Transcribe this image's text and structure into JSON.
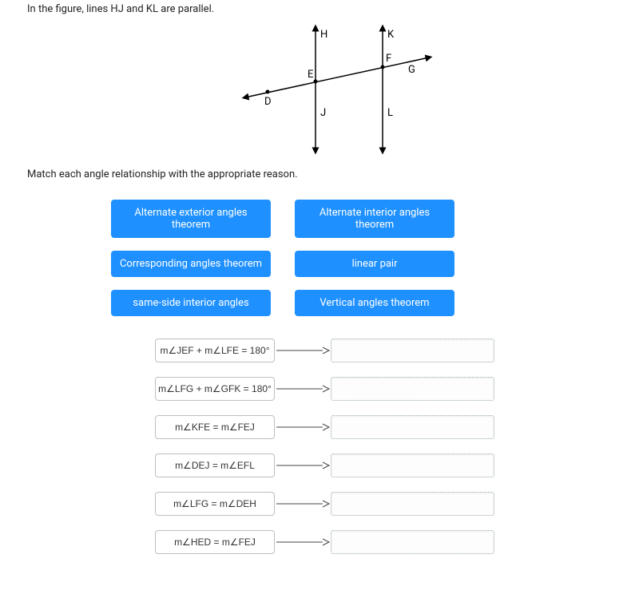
{
  "intro": "In the figure, lines HJ and KL are parallel.",
  "instruction": "Match each angle relationship with the appropriate reason.",
  "figure": {
    "labels": {
      "H": "H",
      "J": "J",
      "K": "K",
      "L": "L",
      "D": "D",
      "E": "E",
      "F": "F",
      "G": "G"
    }
  },
  "chips": [
    [
      "Alternate exterior angles theorem",
      "Alternate interior angles theorem"
    ],
    [
      "Corresponding angles theorem",
      "linear pair"
    ],
    [
      "same-side interior angles",
      "Vertical angles theorem"
    ]
  ],
  "matches": [
    {
      "lhs": "m∠JEF + m∠LFE = 180°"
    },
    {
      "lhs": "m∠LFG + m∠GFK = 180°"
    },
    {
      "lhs": "m∠KFE = m∠FEJ"
    },
    {
      "lhs": "m∠DEJ = m∠EFL"
    },
    {
      "lhs": "m∠LFG = m∠DEH"
    },
    {
      "lhs": "m∠HED = m∠FEJ"
    }
  ]
}
